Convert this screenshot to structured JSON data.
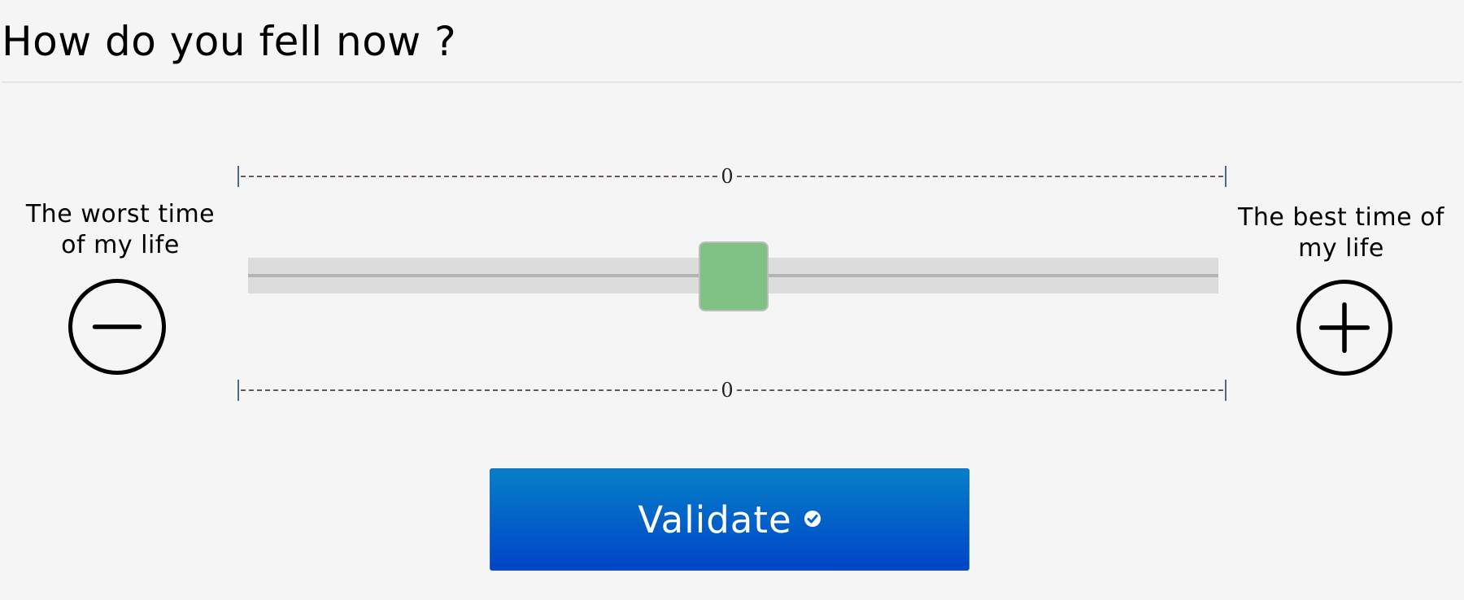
{
  "page": {
    "title": "How do you fell now ?"
  },
  "scale": {
    "min_label": "The worst time of my life",
    "max_label": "The best time of my life",
    "top_value": "0",
    "bottom_value": "0",
    "slider_value": 0,
    "slider_fraction": 0.5
  },
  "buttons": {
    "decrease_icon": "minus-circle-icon",
    "increase_icon": "plus-circle-icon",
    "validate_label": "Validate",
    "validate_icon": "check-circle-icon"
  },
  "colors": {
    "thumb": "#80c283",
    "validate_top": "#0680c8",
    "validate_bottom": "#0044c8"
  }
}
